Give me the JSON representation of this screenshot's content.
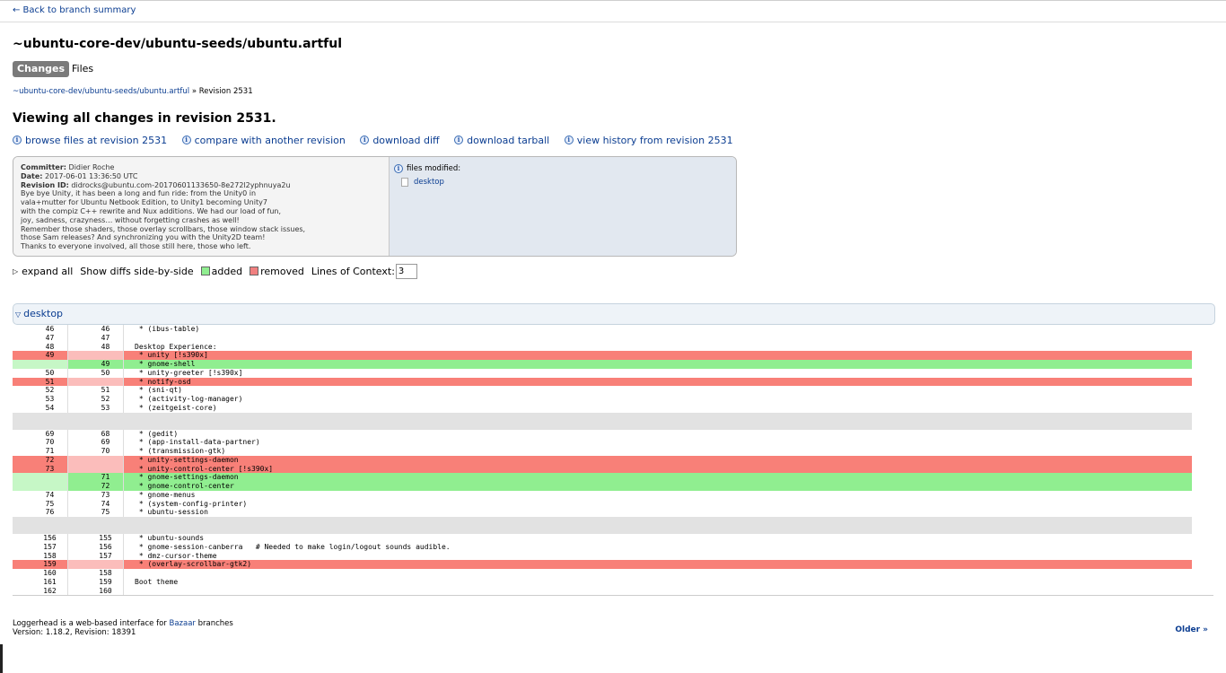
{
  "nav": {
    "back_link": "← Back to branch summary"
  },
  "branch": {
    "title": "~ubuntu-core-dev/ubuntu-seeds/ubuntu.artful"
  },
  "tabs": {
    "changes": "Changes",
    "files": "Files"
  },
  "breadcrumb": {
    "branch": "~ubuntu-core-dev/ubuntu-seeds/ubuntu.artful",
    "separator": "»",
    "current": "Revision 2531"
  },
  "page_title": "Viewing all changes in revision 2531.",
  "actions": [
    "browse files at revision 2531",
    "compare with another revision",
    "download diff",
    "download tarball",
    "view history from revision 2531"
  ],
  "revision": {
    "committer_label": "Committer:",
    "committer": "Didier Roche",
    "date_label": "Date:",
    "date": "2017-06-01 13:36:50 UTC",
    "revid_label": "Revision ID:",
    "revid": "didrocks@ubuntu.com-20170601133650-8e272l2yphnuya2u",
    "message": [
      "Bye bye Unity, it has been a long and fun ride: from the Unity0 in",
      "vala+mutter for Ubuntu Netbook Edition, to Unity1 becoming Unity7",
      "with the compiz C++ rewrite and Nux additions. We had our load of fun,",
      "joy, sadness, crazyness… without forgetting crashes as well!",
      "Remember those shaders, those overlay scrollbars, those window stack issues,",
      "those Sam releases? And synchronizing you with the Unity2D team!",
      "Thanks to everyone involved, all those still here, those who left."
    ]
  },
  "files_modified": {
    "label": "files modified:",
    "files": [
      "desktop"
    ]
  },
  "controls": {
    "expand_all": "expand all",
    "side_by_side": "Show diffs side-by-side",
    "added": "added",
    "removed": "removed",
    "context_label": "Lines of Context:",
    "context_value": "3"
  },
  "colors": {
    "added": "#90ee90",
    "removed": "#f88078",
    "link": "#0b3d91"
  },
  "diff": {
    "file": "desktop",
    "rows": [
      {
        "o": "46",
        "n": "46",
        "t": " * (ibus-table)",
        "k": "ctx"
      },
      {
        "o": "47",
        "n": "47",
        "t": "",
        "k": "ctx"
      },
      {
        "o": "48",
        "n": "48",
        "t": "Desktop Experience:",
        "k": "ctx"
      },
      {
        "o": "49",
        "n": "",
        "t": " * unity [!s390x]",
        "k": "del"
      },
      {
        "o": "",
        "n": "49",
        "t": " * gnome-shell",
        "k": "add"
      },
      {
        "o": "50",
        "n": "50",
        "t": " * unity-greeter [!s390x]",
        "k": "ctx"
      },
      {
        "o": "51",
        "n": "",
        "t": " * notify-osd",
        "k": "del"
      },
      {
        "o": "52",
        "n": "51",
        "t": " * (sni-qt)",
        "k": "ctx"
      },
      {
        "o": "53",
        "n": "52",
        "t": " * (activity-log-manager)",
        "k": "ctx"
      },
      {
        "o": "54",
        "n": "53",
        "t": " * (zeitgeist-core)",
        "k": "ctx"
      },
      {
        "o": "",
        "n": "",
        "t": "",
        "k": "gap"
      },
      {
        "o": "69",
        "n": "68",
        "t": " * (gedit)",
        "k": "ctx"
      },
      {
        "o": "70",
        "n": "69",
        "t": " * (app-install-data-partner)",
        "k": "ctx"
      },
      {
        "o": "71",
        "n": "70",
        "t": " * (transmission-gtk)",
        "k": "ctx"
      },
      {
        "o": "72",
        "n": "",
        "t": " * unity-settings-daemon",
        "k": "del"
      },
      {
        "o": "73",
        "n": "",
        "t": " * unity-control-center [!s390x]",
        "k": "del"
      },
      {
        "o": "",
        "n": "71",
        "t": " * gnome-settings-daemon",
        "k": "add"
      },
      {
        "o": "",
        "n": "72",
        "t": " * gnome-control-center",
        "k": "add"
      },
      {
        "o": "74",
        "n": "73",
        "t": " * gnome-menus",
        "k": "ctx"
      },
      {
        "o": "75",
        "n": "74",
        "t": " * (system-config-printer)",
        "k": "ctx"
      },
      {
        "o": "76",
        "n": "75",
        "t": " * ubuntu-session",
        "k": "ctx"
      },
      {
        "o": "",
        "n": "",
        "t": "",
        "k": "gap"
      },
      {
        "o": "156",
        "n": "155",
        "t": " * ubuntu-sounds",
        "k": "ctx"
      },
      {
        "o": "157",
        "n": "156",
        "t": " * gnome-session-canberra   # Needed to make login/logout sounds audible.",
        "k": "ctx"
      },
      {
        "o": "158",
        "n": "157",
        "t": " * dmz-cursor-theme",
        "k": "ctx"
      },
      {
        "o": "159",
        "n": "",
        "t": " * (overlay-scrollbar-gtk2)",
        "k": "del"
      },
      {
        "o": "160",
        "n": "158",
        "t": "",
        "k": "ctx"
      },
      {
        "o": "161",
        "n": "159",
        "t": "Boot theme",
        "k": "ctx"
      },
      {
        "o": "162",
        "n": "160",
        "t": "",
        "k": "ctx"
      }
    ]
  },
  "footer": {
    "line1_prefix": "Loggerhead is a web-based interface for",
    "bazaar": "Bazaar",
    "line1_suffix": "branches",
    "version": "Version: 1.18.2, Revision: 18391",
    "older": "Older »"
  }
}
